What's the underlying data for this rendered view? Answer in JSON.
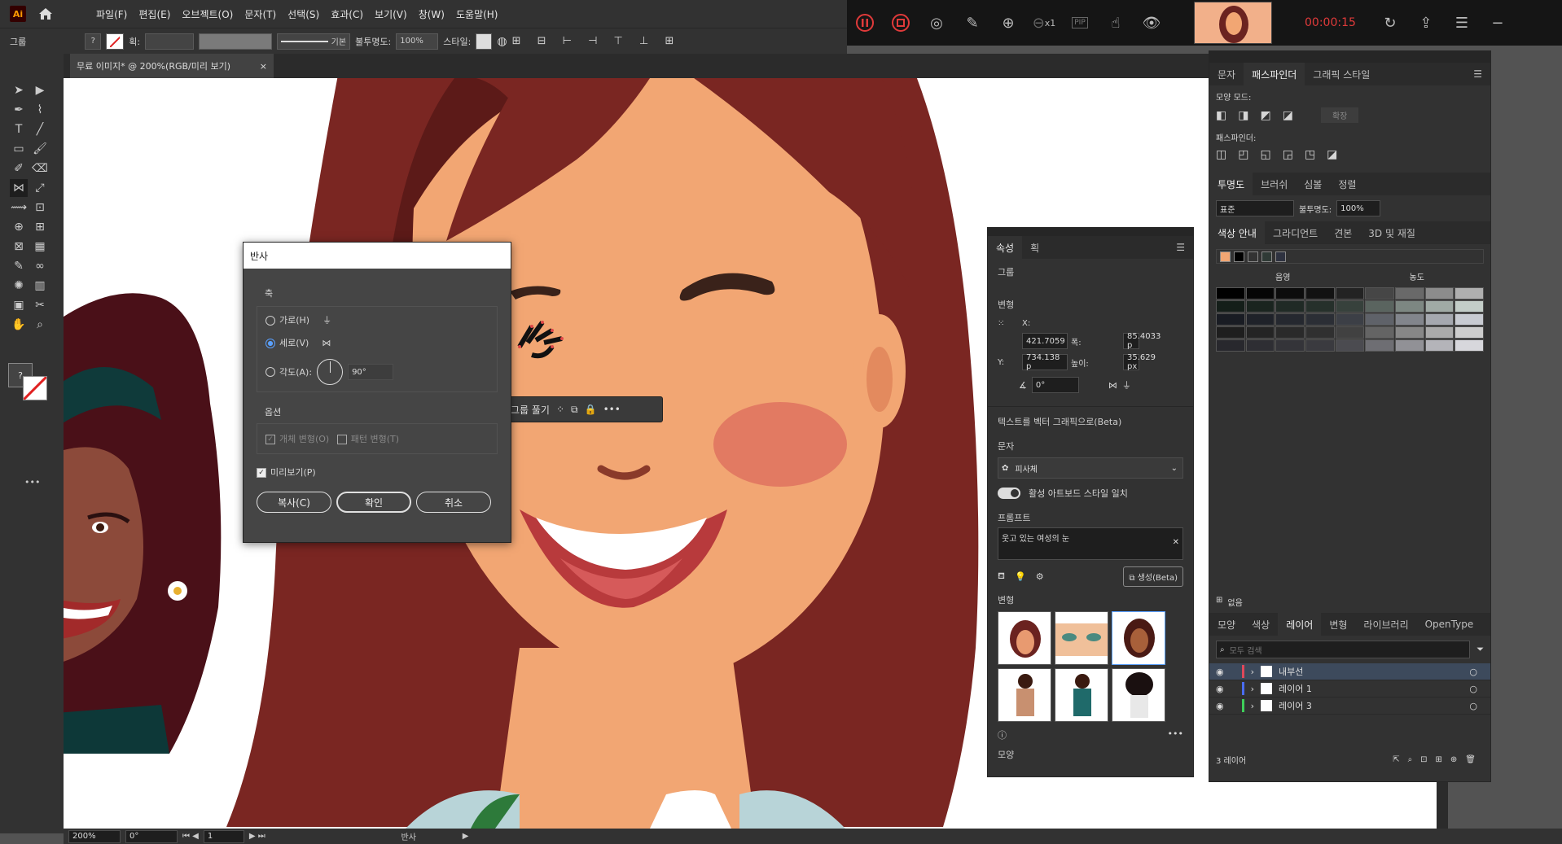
{
  "app": {
    "logo": "Ai",
    "home_icon": "home-icon"
  },
  "menu": [
    "파일(F)",
    "편집(E)",
    "오브젝트(O)",
    "문자(T)",
    "선택(S)",
    "효과(C)",
    "보기(V)",
    "창(W)",
    "도움말(H)"
  ],
  "control": {
    "group_label": "그룹",
    "stroke_label": "획:",
    "stroke_style": "기본",
    "opacity_label": "불투명도:",
    "opacity_value": "100%",
    "style_label": "스타일:"
  },
  "recorder": {
    "time": "00:00:15",
    "speed": "x1",
    "pip": "PIP",
    "time_color": "#e03a3a"
  },
  "document": {
    "tab_title": "무료 이미지* @ 200%(RGB/미리 보기)",
    "close": "×"
  },
  "dialog": {
    "title": "반사",
    "axis_label": "축",
    "horizontal": "가로(H)",
    "vertical": "세로(V)",
    "angle": "각도(A):",
    "angle_value": "90°",
    "options_label": "옵션",
    "transform_objects": "개체 변형(O)",
    "transform_patterns": "패턴 변형(T)",
    "preview": "미리보기(P)",
    "copy": "복사(C)",
    "ok": "확인",
    "cancel": "취소",
    "selected_axis": "vertical",
    "preview_checked": true
  },
  "context_bar": {
    "ungroup": "그룹 풀기"
  },
  "properties": {
    "tabs": [
      "속성",
      "획"
    ],
    "group": "그룹",
    "transform": "변형",
    "x_label": "X:",
    "x": "421.7059",
    "w_label": "폭:",
    "w": "85.4033 p",
    "y_label": "Y:",
    "y": "734.138 p",
    "h_label": "높이:",
    "h": "35.629 px",
    "angle": "0°",
    "text_to_vector": "텍스트를 벡터 그래픽으로(Beta)",
    "subject_label": "문자",
    "subject_value": "피사체",
    "match_style": "활성 아트보드 스타일 일치",
    "prompt_label": "프롬프트",
    "prompt_value": "웃고 있는 여성의 눈",
    "generate": "생성(Beta)",
    "variations": "변형",
    "appearance": "모양"
  },
  "pathfinder": {
    "tabs": [
      "문자",
      "패스파인더",
      "그래픽 스타일"
    ],
    "shape_modes": "모양 모드:",
    "expand": "확장",
    "pathfinders": "패스파인더:"
  },
  "transparency": {
    "tabs": [
      "투명도",
      "브러쉬",
      "심볼",
      "정렬"
    ],
    "mode": "표준",
    "opacity_label": "불투명도:",
    "opacity": "100%"
  },
  "color_guide": {
    "tabs": [
      "색상 안내",
      "그라디언트",
      "견본",
      "3D 및 재질"
    ],
    "shade": "음영",
    "tint": "농도",
    "none": "없음",
    "base_colors": [
      "#f2a673",
      "#000000",
      "#333333",
      "#2f3a36",
      "#2e3240"
    ]
  },
  "layers": {
    "tabs": [
      "모양",
      "색상",
      "레이어",
      "변형",
      "라이브러리",
      "OpenType"
    ],
    "search_placeholder": "모두 검색",
    "items": [
      {
        "name": "내부선",
        "color": "#e0485a"
      },
      {
        "name": "레이어 1",
        "color": "#4a6cf0"
      },
      {
        "name": "레이어 3",
        "color": "#3ecf5a"
      }
    ],
    "count": "3 레이어"
  },
  "status": {
    "zoom": "200%",
    "rotation": "0°",
    "page": "1",
    "tool": "반사"
  }
}
